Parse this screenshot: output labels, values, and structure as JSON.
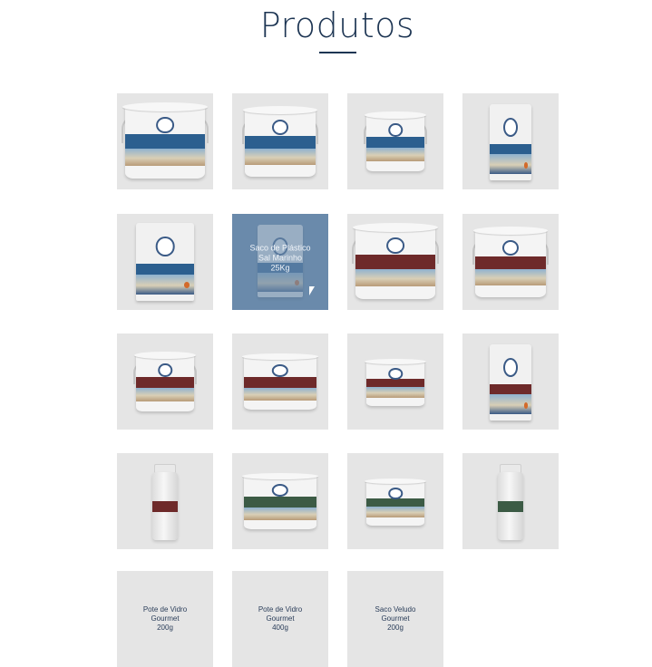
{
  "page": {
    "title": "Produtos"
  },
  "colors": {
    "navy": "#1d3553",
    "blue_band": "#2c5f8f",
    "maroon_band": "#6e2a2a",
    "green_band": "#3c5b45",
    "tile_bg": "#e5e5e5",
    "hover_overlay": "#6a8aab"
  },
  "products": [
    {
      "kind": "bucket-large",
      "band": "blue",
      "caption": ""
    },
    {
      "kind": "bucket-medium",
      "band": "blue",
      "caption": ""
    },
    {
      "kind": "bucket-small",
      "band": "blue",
      "caption": ""
    },
    {
      "kind": "bag-tall",
      "band": "blue",
      "caption": ""
    },
    {
      "kind": "bag-wide",
      "band": "blue",
      "caption": ""
    },
    {
      "kind": "bag-hover",
      "band": "blue",
      "caption_lines": [
        "Saco de Plástico",
        "Sal Marinho",
        "25Kg"
      ]
    },
    {
      "kind": "bucket-large",
      "band": "maroon",
      "caption": ""
    },
    {
      "kind": "bucket-medium",
      "band": "maroon",
      "caption": ""
    },
    {
      "kind": "bucket-small",
      "band": "maroon",
      "caption": ""
    },
    {
      "kind": "tub-wide",
      "band": "maroon",
      "caption": ""
    },
    {
      "kind": "tub-small",
      "band": "maroon",
      "caption": ""
    },
    {
      "kind": "bag-tall",
      "band": "maroon",
      "caption": ""
    },
    {
      "kind": "jar",
      "band": "maroon",
      "caption": ""
    },
    {
      "kind": "tub-wide",
      "band": "green",
      "caption": ""
    },
    {
      "kind": "tub-small",
      "band": "green",
      "caption": ""
    },
    {
      "kind": "jar",
      "band": "green",
      "caption": ""
    },
    {
      "kind": "text",
      "caption_lines": [
        "Pote de Vidro",
        "Gourmet",
        "200g"
      ]
    },
    {
      "kind": "text",
      "caption_lines": [
        "Pote de Vidro",
        "Gourmet",
        "400g"
      ]
    },
    {
      "kind": "text",
      "caption_lines": [
        "Saco Veludo",
        "Gourmet",
        "200g"
      ]
    }
  ]
}
